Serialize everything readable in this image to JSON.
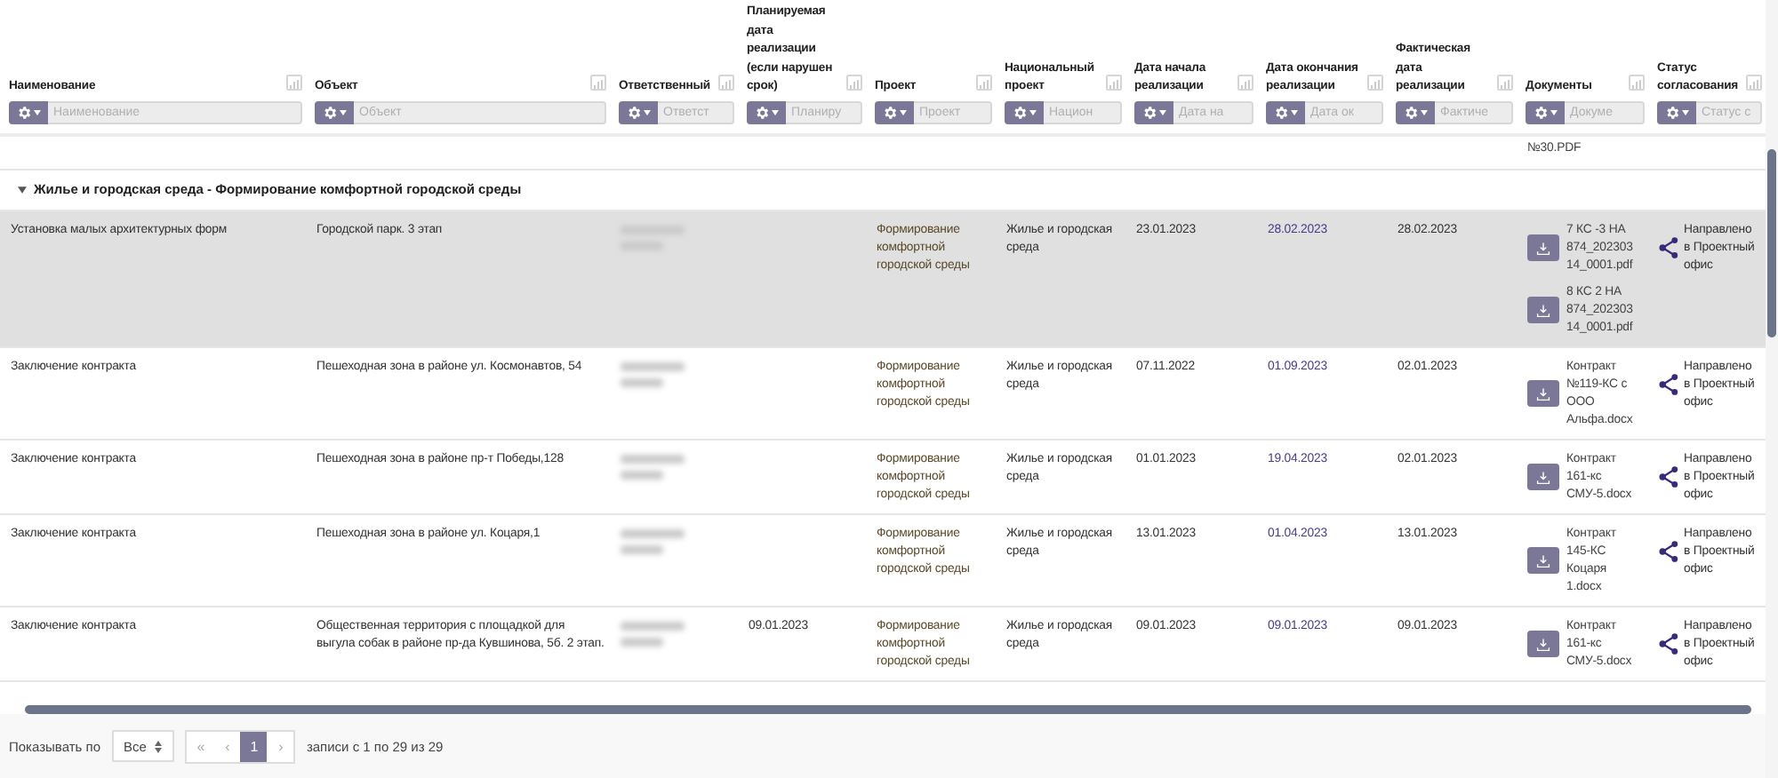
{
  "columns": [
    {
      "label": "Наименование",
      "placeholder": "Наименование"
    },
    {
      "label": "Объект",
      "placeholder": "Объект"
    },
    {
      "label": "Ответственный",
      "placeholder": "Ответст"
    },
    {
      "label": "Планируемая дата реализации (если нарушен срок)",
      "placeholder": "Планиру"
    },
    {
      "label": "Проект",
      "placeholder": "Проект"
    },
    {
      "label": "Национальный проект",
      "placeholder": "Национ"
    },
    {
      "label": "Дата начала реализации",
      "placeholder": "Дата на"
    },
    {
      "label": "Дата окончания реализации",
      "placeholder": "Дата ок"
    },
    {
      "label": "Фактическая дата реализации",
      "placeholder": "Фактиче"
    },
    {
      "label": "Документы",
      "placeholder": "Докуме"
    },
    {
      "label": "Статус согласования",
      "placeholder": "Статус с"
    }
  ],
  "cut_row": {
    "documents": [
      "№30.PDF"
    ]
  },
  "group": {
    "title": "Жилье и городская среда - Формирование комфортной городской среды",
    "expanded": true
  },
  "rows": [
    {
      "selected": true,
      "name": "Установка малых архитектурных форм",
      "object": "Городской парк. 3 этап",
      "project": "Формирование комфортной городской среды",
      "national": "Жилье и городская среда",
      "start": "23.01.2023",
      "end": "28.02.2023",
      "actual": "28.02.2023",
      "documents": [
        "7 КС -3 НА 874_202303 14_0001.pdf",
        "8 КС 2 НА 874_202303 14_0001.pdf"
      ],
      "status": "Направлено в Проектный офис"
    },
    {
      "selected": false,
      "name": "Заключение контракта",
      "object": "Пешеходная зона в районе ул. Космонавтов, 54",
      "project": "Формирование комфортной городской среды",
      "national": "Жилье и городская среда",
      "start": "07.11.2022",
      "end": "01.09.2023",
      "actual": "02.01.2023",
      "documents": [
        "Контракт №119-КС с ООО Альфа.docx"
      ],
      "status": "Направлено в Проектный офис"
    },
    {
      "selected": false,
      "name": "Заключение контракта",
      "object": "Пешеходная зона в районе пр-т Победы,128",
      "project": "Формирование комфортной городской среды",
      "national": "Жилье и городская среда",
      "start": "01.01.2023",
      "end": "19.04.2023",
      "actual": "02.01.2023",
      "documents": [
        "Контракт 161-кс СМУ-5.docx"
      ],
      "status": "Направлено в Проектный офис"
    },
    {
      "selected": false,
      "name": "Заключение контракта",
      "object": "Пешеходная зона в районе ул. Коцаря,1",
      "project": "Формирование комфортной городской среды",
      "national": "Жилье и городская среда",
      "start": "13.01.2023",
      "end": "01.04.2023",
      "actual": "13.01.2023",
      "documents": [
        "Контракт 145-КС Коцаря 1.docx"
      ],
      "status": "Направлено в Проектный офис"
    },
    {
      "selected": false,
      "name": "Заключение контракта",
      "object": "Общественная территория с площадкой для выгула собак в районе пр-да Кувшинова, 5б. 2 этап.",
      "planned": "09.01.2023",
      "project": "Формирование комфортной городской среды",
      "national": "Жилье и городская среда",
      "start": "09.01.2023",
      "end": "09.01.2023",
      "actual": "09.01.2023",
      "documents": [
        "Контракт 161-кс СМУ-5.docx"
      ],
      "status": "Направлено в Проектный офис"
    }
  ],
  "footer": {
    "show_label": "Показывать по",
    "page_size": "Все",
    "pager": [
      {
        "label": "«",
        "selected": false
      },
      {
        "label": "‹",
        "selected": false
      },
      {
        "label": "1",
        "selected": true
      },
      {
        "label": "›",
        "selected": false
      }
    ],
    "info": "записи с 1 по 29 из 29"
  }
}
